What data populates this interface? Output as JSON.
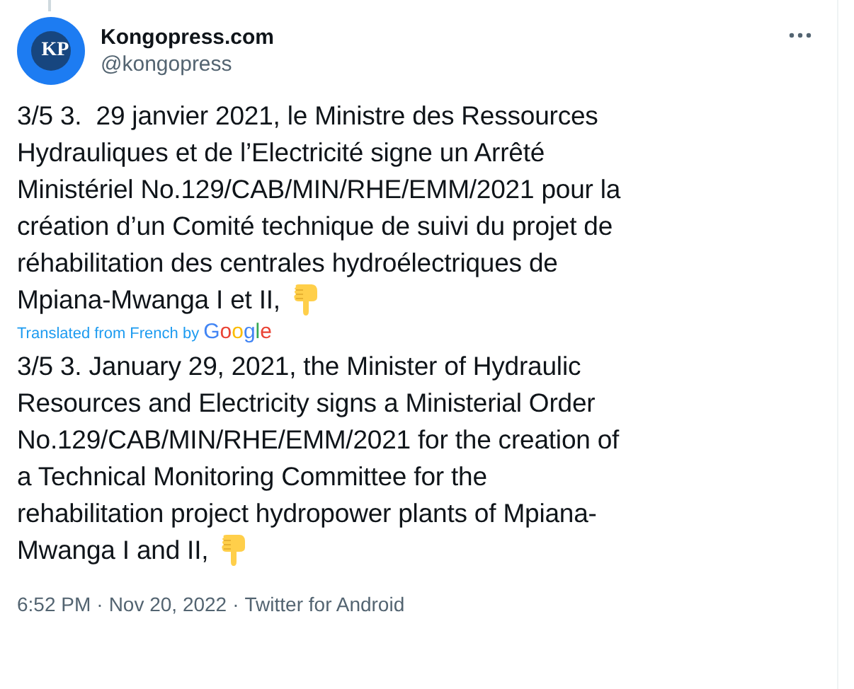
{
  "author": {
    "avatar_text": "KP",
    "name": "Kongopress.com",
    "handle": "@kongopress"
  },
  "original_lines": [
    "3/5 3.  29 janvier 2021, le Ministre des Ressources",
    "Hydrauliques et de l’Electricité signe un Arrêté",
    "Ministériel No.129/CAB/MIN/RHE/EMM/2021 pour la",
    "création d’un Comité technique de suivi du projet de",
    "réhabilitation des centrales hydroélectriques de",
    "Mpiana-Mwanga I et II,"
  ],
  "translation_note": {
    "text": "Translated from French by",
    "provider": "Google"
  },
  "translated_lines": [
    "3/5 3. January 29, 2021, the Minister of Hydraulic",
    "Resources and Electricity signs a Ministerial Order",
    "No.129/CAB/MIN/RHE/EMM/2021 for the creation of",
    "a Technical Monitoring Committee for the",
    "rehabilitation project hydropower plants of Mpiana-",
    "Mwanga I and II,"
  ],
  "footer": {
    "time": "6:52 PM",
    "date": "Nov 20, 2022",
    "source": "Twitter for Android",
    "separator": "·"
  }
}
